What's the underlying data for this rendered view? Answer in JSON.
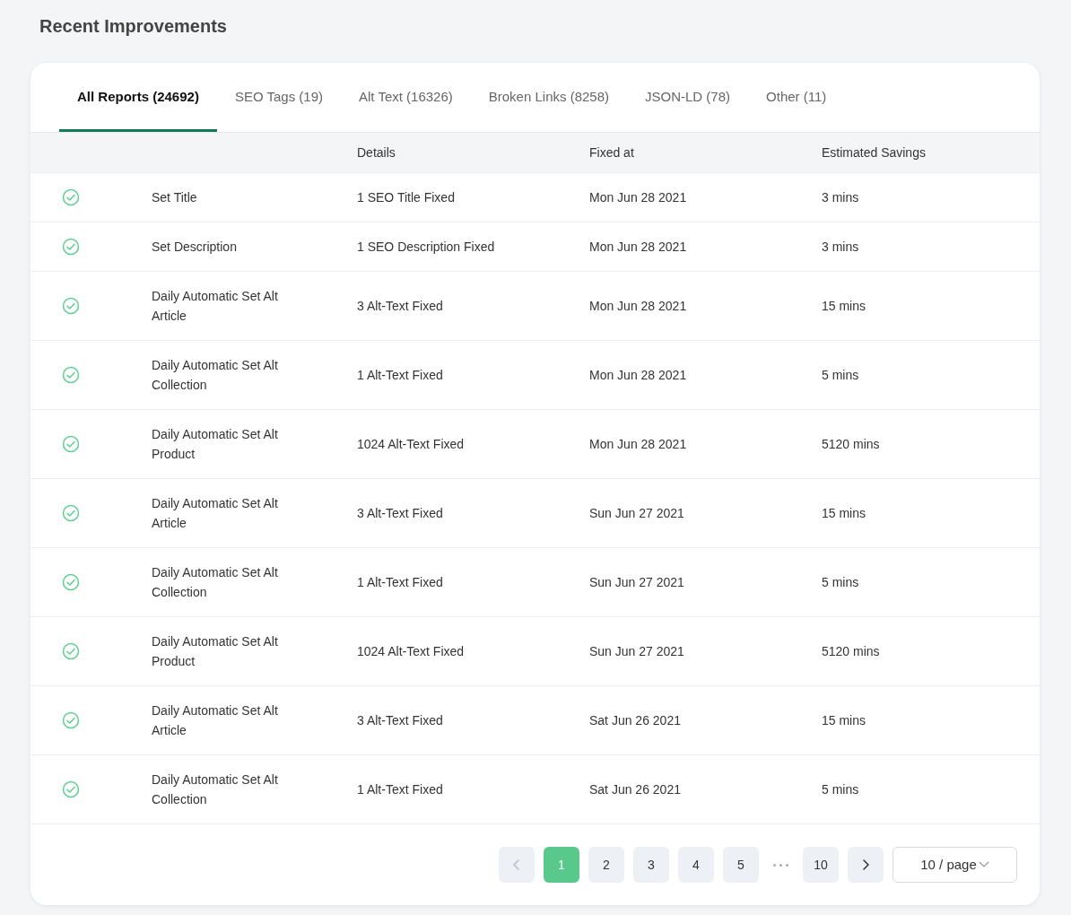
{
  "title": "Recent Improvements",
  "tabs": [
    {
      "label": "All Reports (24692)",
      "selected": true
    },
    {
      "label": "SEO Tags (19)",
      "selected": false
    },
    {
      "label": "Alt Text (16326)",
      "selected": false
    },
    {
      "label": "Broken Links (8258)",
      "selected": false
    },
    {
      "label": "JSON-LD (78)",
      "selected": false
    },
    {
      "label": "Other (11)",
      "selected": false
    }
  ],
  "table": {
    "columns": [
      "Details",
      "Fixed at",
      "Estimated Savings"
    ],
    "rows": [
      {
        "name": "Set Title",
        "details": "1 SEO Title Fixed",
        "fixed_at": "Mon Jun 28 2021",
        "savings": "3 mins"
      },
      {
        "name": "Set Description",
        "details": "1 SEO Description Fixed",
        "fixed_at": "Mon Jun 28 2021",
        "savings": "3 mins"
      },
      {
        "name": "Daily Automatic Set Alt Article",
        "details": "3 Alt-Text Fixed",
        "fixed_at": "Mon Jun 28 2021",
        "savings": "15 mins"
      },
      {
        "name": "Daily Automatic Set Alt Collection",
        "details": "1 Alt-Text Fixed",
        "fixed_at": "Mon Jun 28 2021",
        "savings": "5 mins"
      },
      {
        "name": "Daily Automatic Set Alt Product",
        "details": "1024 Alt-Text Fixed",
        "fixed_at": "Mon Jun 28 2021",
        "savings": "5120 mins"
      },
      {
        "name": "Daily Automatic Set Alt Article",
        "details": "3 Alt-Text Fixed",
        "fixed_at": "Sun Jun 27 2021",
        "savings": "15 mins"
      },
      {
        "name": "Daily Automatic Set Alt Collection",
        "details": "1 Alt-Text Fixed",
        "fixed_at": "Sun Jun 27 2021",
        "savings": "5 mins"
      },
      {
        "name": "Daily Automatic Set Alt Product",
        "details": "1024 Alt-Text Fixed",
        "fixed_at": "Sun Jun 27 2021",
        "savings": "5120 mins"
      },
      {
        "name": "Daily Automatic Set Alt Article",
        "details": "3 Alt-Text Fixed",
        "fixed_at": "Sat Jun 26 2021",
        "savings": "15 mins"
      },
      {
        "name": "Daily Automatic Set Alt Collection",
        "details": "1 Alt-Text Fixed",
        "fixed_at": "Sat Jun 26 2021",
        "savings": "5 mins"
      }
    ]
  },
  "pagination": {
    "prev_disabled": true,
    "next_disabled": false,
    "pages": [
      {
        "label": "1",
        "selected": true
      },
      {
        "label": "2",
        "selected": false
      },
      {
        "label": "3",
        "selected": false
      },
      {
        "label": "4",
        "selected": false
      },
      {
        "label": "5",
        "selected": false
      },
      {
        "label": "10",
        "selected": false
      }
    ],
    "page_size": "10 / page"
  }
}
